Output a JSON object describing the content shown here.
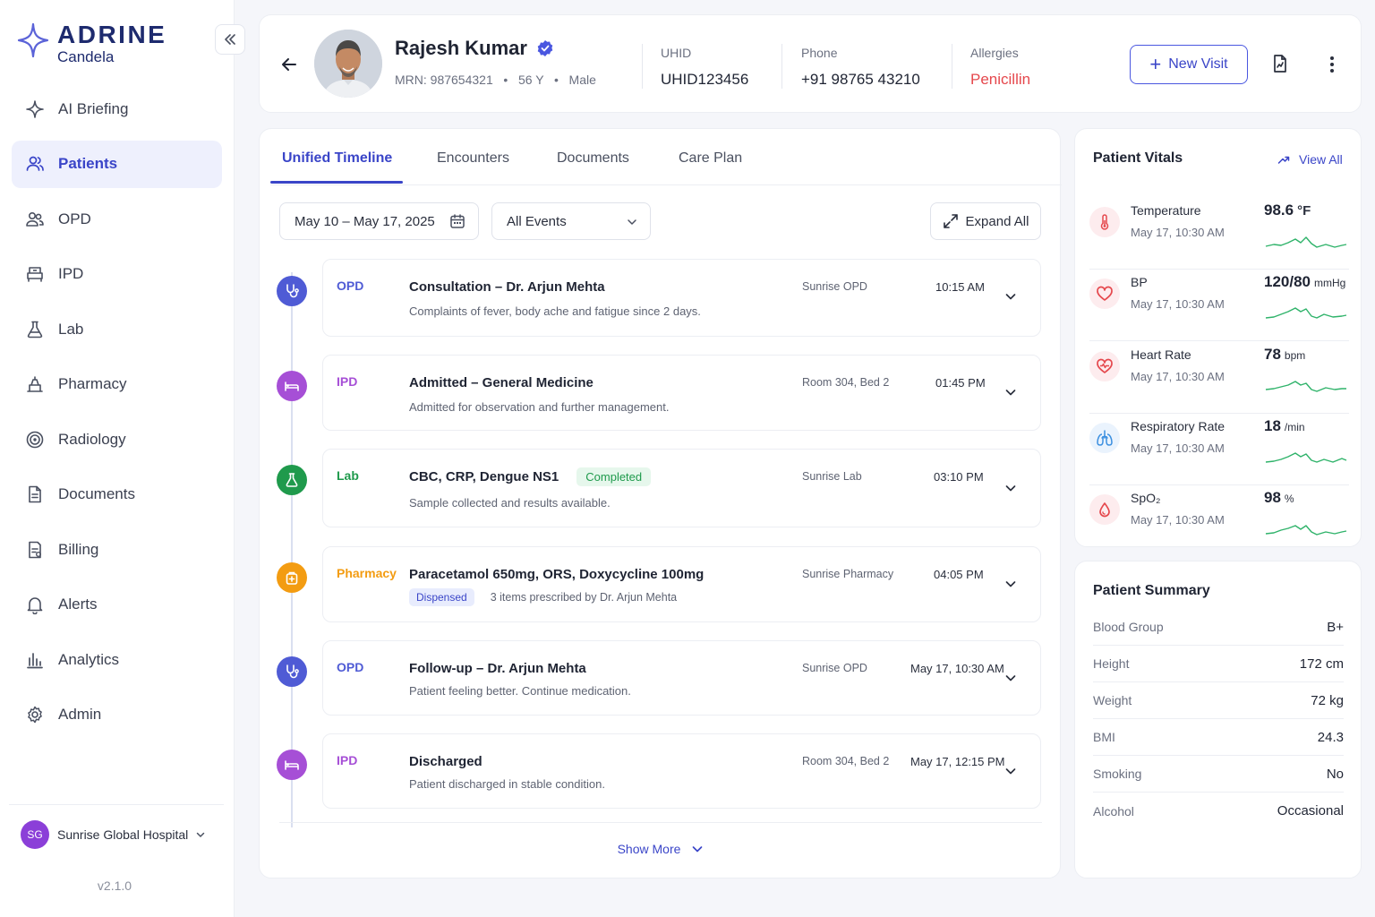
{
  "app": {
    "brand": "ADRINE",
    "subbrand": "Candela",
    "version": "v2.1.0"
  },
  "sidebar": {
    "items": [
      {
        "label": "AI Briefing"
      },
      {
        "label": "Patients"
      },
      {
        "label": "OPD"
      },
      {
        "label": "IPD"
      },
      {
        "label": "Lab"
      },
      {
        "label": "Pharmacy"
      },
      {
        "label": "Radiology"
      },
      {
        "label": "Documents"
      },
      {
        "label": "Billing"
      },
      {
        "label": "Alerts"
      },
      {
        "label": "Analytics"
      },
      {
        "label": "Admin"
      }
    ],
    "active_index": 1,
    "hospital": {
      "initials": "SG",
      "name": "Sunrise Global Hospital"
    }
  },
  "patient": {
    "name": "Rajesh Kumar",
    "mrn": "MRN: 987654321",
    "age": "56 Y",
    "sex": "Male",
    "uhid_label": "UHID",
    "uhid": "UHID123456",
    "phone_label": "Phone",
    "phone": "+91 98765 43210",
    "allergies_label": "Allergies",
    "allergies": "Penicillin",
    "new_visit_label": "New Visit"
  },
  "tabs": [
    "Unified Timeline",
    "Encounters",
    "Documents",
    "Care Plan"
  ],
  "filters": {
    "date_range": "May 10 – May 17, 2025",
    "event_filter": "All Events",
    "expand_label": "Expand All"
  },
  "timeline": [
    {
      "type": "OPD",
      "title": "Consultation – Dr. Arjun Mehta",
      "desc": "Complaints of fever, body ache and fatigue since 2 days.",
      "location": "Sunrise OPD",
      "time": "10:15 AM",
      "icon": "stethoscope-icon",
      "color": "#4f5bd5"
    },
    {
      "type": "IPD",
      "title": "Admitted – General Medicine",
      "desc": "Admitted for observation and further management.",
      "location": "Room 304, Bed 2",
      "time": "01:45 PM",
      "icon": "bed-icon",
      "color": "#a64fd6"
    },
    {
      "type": "Lab",
      "title": "CBC, CRP, Dengue NS1",
      "badge": "Completed",
      "desc": "Sample collected and results available.",
      "location": "Sunrise Lab",
      "time": "03:10 PM",
      "icon": "flask-icon",
      "color": "#1f9a4c"
    },
    {
      "type": "Pharmacy",
      "title": "Paracetamol 650mg, ORS, Doxycycline 100mg",
      "badge": "Dispensed",
      "desc": "3 items prescribed by Dr. Arjun Mehta",
      "location": "Sunrise Pharmacy",
      "time": "04:05 PM",
      "icon": "pill-bag-icon",
      "color": "#f39c12"
    },
    {
      "type": "OPD",
      "title": "Follow-up – Dr. Arjun Mehta",
      "desc": "Patient feeling better. Continue medication.",
      "location": "Sunrise OPD",
      "time": "May 17, 10:30 AM",
      "icon": "stethoscope-icon",
      "color": "#4f5bd5"
    },
    {
      "type": "IPD",
      "title": "Discharged",
      "desc": "Patient discharged in stable condition.",
      "location": "Room 304, Bed 2",
      "time": "May 17, 12:15 PM",
      "icon": "bed-icon",
      "color": "#a64fd6"
    }
  ],
  "show_more_label": "Show More",
  "vitals": {
    "title": "Patient Vitals",
    "view_all": "View All",
    "items": [
      {
        "name": "Temperature",
        "date": "May 17, 10:30 AM",
        "value": "98.6",
        "unit": "°F",
        "icon": "thermometer-icon",
        "color": "#e5484d"
      },
      {
        "name": "BP",
        "date": "May 17, 10:30 AM",
        "value": "120/80",
        "unit": "mmHg",
        "icon": "heart-icon",
        "color": "#e5484d"
      },
      {
        "name": "Heart Rate",
        "date": "May 17, 10:30 AM",
        "value": "78",
        "unit": "bpm",
        "icon": "heart-pulse-icon",
        "color": "#e5484d"
      },
      {
        "name": "Respiratory Rate",
        "date": "May 17, 10:30 AM",
        "value": "18",
        "unit": "/min",
        "icon": "lungs-icon",
        "color": "#3b8fe0"
      },
      {
        "name": "SpO₂",
        "date": "May 17, 10:30 AM",
        "value": "98",
        "unit": "%",
        "icon": "drop-icon",
        "color": "#e5484d"
      }
    ],
    "sparkline_color": "#2fb36a"
  },
  "summary": {
    "title": "Patient Summary",
    "rows": [
      {
        "label": "Blood Group",
        "value": "B+"
      },
      {
        "label": "Height",
        "value": "172 cm"
      },
      {
        "label": "Weight",
        "value": "72 kg"
      },
      {
        "label": "BMI",
        "value": "24.3"
      },
      {
        "label": "Smoking",
        "value": "No"
      },
      {
        "label": "Alcohol",
        "value": "Occasional"
      }
    ]
  },
  "colors": {
    "accent": "#3a45c8",
    "allergy": "#e5484d",
    "completed": "#1f9a4c"
  }
}
